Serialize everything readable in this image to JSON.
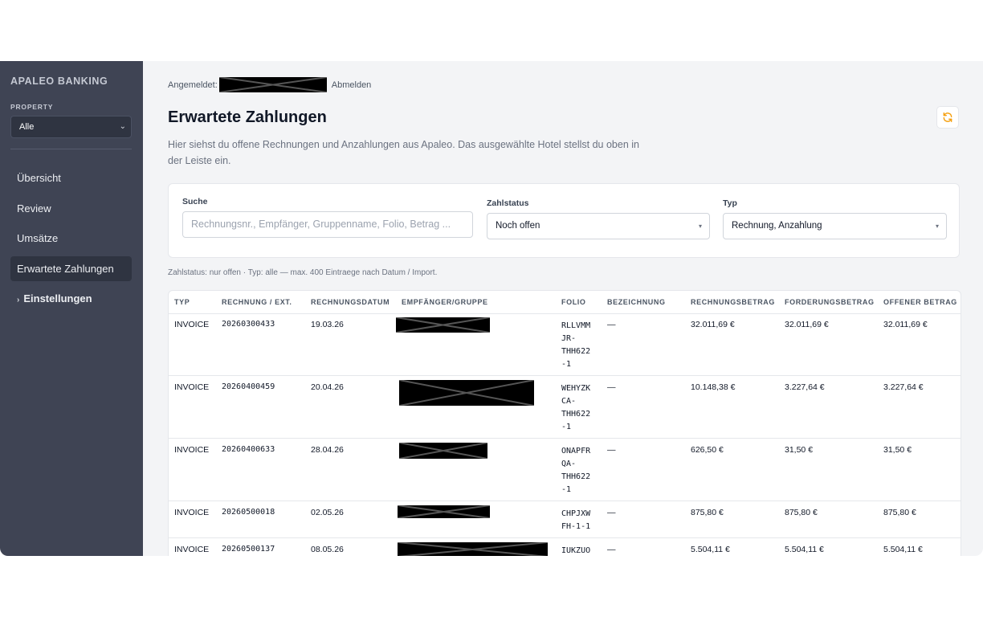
{
  "sidebar": {
    "brand": "APALEO BANKING",
    "property_label": "PROPERTY",
    "property_value": "Alle",
    "items": [
      {
        "label": "Übersicht"
      },
      {
        "label": "Review"
      },
      {
        "label": "Umsätze"
      },
      {
        "label": "Erwartete Zahlungen",
        "active": true
      },
      {
        "label": "Einstellungen",
        "expandable": true
      }
    ]
  },
  "header": {
    "logged_in_label": "Angemeldet:",
    "logout_label": "Abmelden",
    "title": "Erwartete Zahlungen",
    "description": "Hier siehst du offene Rechnungen und Anzahlungen aus Apaleo. Das ausgewählte Hotel stellst du oben in der Leiste ein."
  },
  "filters": {
    "search_label": "Suche",
    "search_placeholder": "Rechnungsnr., Empfänger, Gruppenname, Folio, Betrag ...",
    "status_label": "Zahlstatus",
    "status_value": "Noch offen",
    "type_label": "Typ",
    "type_value": "Rechnung, Anzahlung"
  },
  "info_text": "Zahlstatus: nur offen · Typ: alle — max. 400 Eintraege nach Datum / Import.",
  "table": {
    "columns": [
      "TYP",
      "RECHNUNG / EXT.",
      "RECHNUNGSDATUM",
      "EMPFÄNGER/GRUPPE",
      "FOLIO",
      "BEZEICHNUNG",
      "RECHNUNGSBETRAG",
      "FORDERUNGSBETRAG",
      "OFFENER BETRAG"
    ],
    "rows": [
      {
        "typ": "INVOICE",
        "rechnung": "20260300433",
        "datum": "19.03.26",
        "folio": "RLLVMM\nJR-\nTHH622\n-1",
        "bezeichnung": "—",
        "rechnungsbetrag": "32.011,69 €",
        "forderungsbetrag": "32.011,69 €",
        "offen": "32.011,69 €"
      },
      {
        "typ": "INVOICE",
        "rechnung": "20260400459",
        "datum": "20.04.26",
        "folio": "WEHYZK\nCA-\nTHH622\n-1",
        "bezeichnung": "—",
        "rechnungsbetrag": "10.148,38 €",
        "forderungsbetrag": "3.227,64 €",
        "offen": "3.227,64 €"
      },
      {
        "typ": "INVOICE",
        "rechnung": "20260400633",
        "datum": "28.04.26",
        "folio": "ONAPFR\nQA-\nTHH622\n-1",
        "bezeichnung": "—",
        "rechnungsbetrag": "626,50 €",
        "forderungsbetrag": "31,50 €",
        "offen": "31,50 €"
      },
      {
        "typ": "INVOICE",
        "rechnung": "20260500018",
        "datum": "02.05.26",
        "folio": "CHPJXW\nFH-1-1",
        "bezeichnung": "—",
        "rechnungsbetrag": "875,80 €",
        "forderungsbetrag": "875,80 €",
        "offen": "875,80 €"
      },
      {
        "typ": "INVOICE",
        "rechnung": "20260500137",
        "datum": "08.05.26",
        "folio": "IUKZUO",
        "bezeichnung": "—",
        "rechnungsbetrag": "5.504,11 €",
        "forderungsbetrag": "5.504,11 €",
        "offen": "5.504,11 €"
      }
    ]
  },
  "colors": {
    "sidebar_bg": "#3f4454",
    "active_item_bg": "#2f3441",
    "refresh_icon": "#f59e0b",
    "redaction": "#000000"
  },
  "icons": {
    "refresh": "refresh-icon",
    "dropdown": "chevron-down-icon",
    "expand": "chevron-right-icon"
  }
}
